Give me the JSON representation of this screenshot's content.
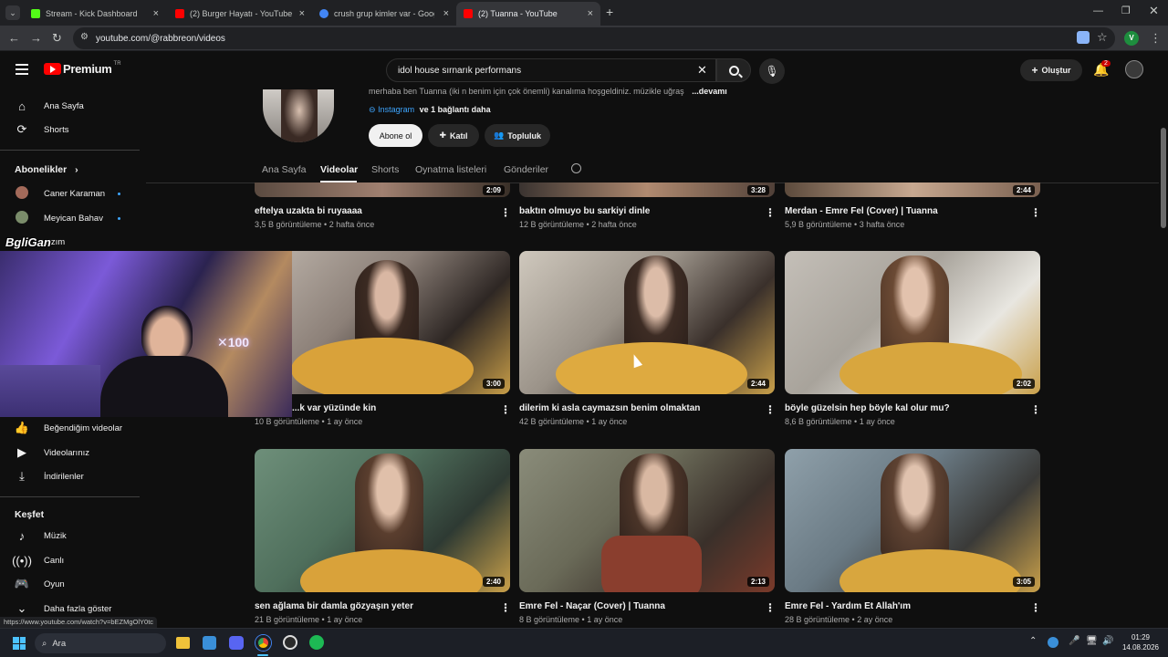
{
  "browser": {
    "tabs": [
      {
        "title": "Stream - Kick Dashboard",
        "color": "#53fc18"
      },
      {
        "title": "(2) Burger Hayatı - YouTube",
        "color": "#ff0000"
      },
      {
        "title": "crush grup kimler var - Google",
        "color": "#4285f4"
      },
      {
        "title": "(2) Tuanna - YouTube",
        "color": "#ff0000"
      }
    ],
    "new_tab": "+",
    "url": "youtube.com/@rabbreon/videos",
    "profile_initial": "V"
  },
  "youtube": {
    "logo": "Premium",
    "logo_region": "TR",
    "search_value": "idol house sırnarık performans",
    "create_label": "Oluştur",
    "notif_count": "2"
  },
  "sidebar": {
    "items_top": [
      {
        "label": "Ana Sayfa",
        "icon": "home-icon"
      },
      {
        "label": "Shorts",
        "icon": "shorts-icon"
      }
    ],
    "subscriptions_heading": "Abonelikler",
    "subscriptions": [
      {
        "label": "Caner Karaman"
      },
      {
        "label": "Meyican Bahav"
      },
      {
        "label": "...zım"
      }
    ],
    "items_you": [
      {
        "label": "Beğendiğim videolar",
        "icon": "thumbs-up-icon"
      },
      {
        "label": "Videolarınız",
        "icon": "play-box-icon"
      },
      {
        "label": "İndirilenler",
        "icon": "download-icon"
      }
    ],
    "explore_heading": "Keşfet",
    "explore": [
      {
        "label": "Müzik",
        "icon": "music-icon"
      },
      {
        "label": "Canlı",
        "icon": "live-icon"
      },
      {
        "label": "Oyun",
        "icon": "game-icon"
      },
      {
        "label": "Daha fazla göster",
        "icon": "chevron-down-icon"
      }
    ]
  },
  "channel": {
    "description": "merhaba ben Tuanna (iki n benim için çok önemli) kanalıma hoşgeldiniz. müzikle uğraş",
    "more": "...devamı",
    "links": "Instagram",
    "links_more": "ve 1 bağlantı daha",
    "subscribe": "Abone ol",
    "join": "Katıl",
    "community": "Topluluk",
    "tabs": [
      "Ana Sayfa",
      "Videolar",
      "Shorts",
      "Oynatma listeleri",
      "Gönderiler"
    ],
    "active_tab": "Videolar"
  },
  "videos": [
    {
      "title": "eftelya uzakta bi ruyaaaa",
      "meta": "3,5 B görüntüleme • 2 hafta önce",
      "duration": "2:09"
    },
    {
      "title": "baktın olmuyo bu sarkiyi dinle",
      "meta": "12 B görüntüleme • 2 hafta önce",
      "duration": "3:28"
    },
    {
      "title": "Merdan - Emre Fel (Cover) | Tuanna",
      "meta": "5,9 B görüntüleme • 3 hafta önce",
      "duration": "2:44"
    },
    {
      "title": "...k var yüzünde kin",
      "meta": "10 B görüntüleme • 1 ay önce",
      "duration": "3:00"
    },
    {
      "title": "dilerim ki asla caymazsın benim olmaktan",
      "meta": "42 B görüntüleme • 1 ay önce",
      "duration": "2:44"
    },
    {
      "title": "böyle güzelsin hep böyle kal olur mu?",
      "meta": "8,6 B görüntüleme • 1 ay önce",
      "duration": "2:02"
    },
    {
      "title": "sen ağlama bir damla gözyaşın yeter",
      "meta": "21 B görüntüleme • 1 ay önce",
      "duration": "2:40"
    },
    {
      "title": "Emre Fel - Naçar (Cover) | Tuanna",
      "meta": "8 B görüntüleme • 1 ay önce",
      "duration": "2:13"
    },
    {
      "title": "Emre Fel - Yardım Et Allah'ım",
      "meta": "28 B görüntüleme • 2 ay önce",
      "duration": "3:05"
    }
  ],
  "overlay": {
    "streamer_tag": "BgliGan",
    "status_url": "https://www.youtube.com/watch?v=bEZMgOlY0tc"
  },
  "taskbar": {
    "search": "Ara",
    "time": "01:29",
    "date": "14.08.2026"
  }
}
